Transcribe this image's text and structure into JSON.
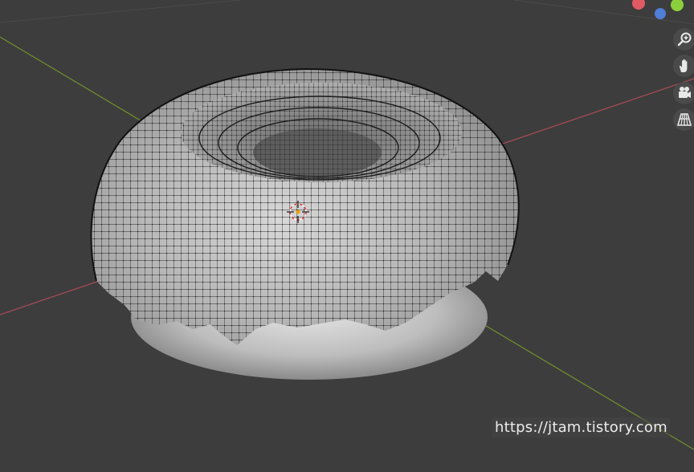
{
  "viewport": {
    "background_color": "#3d3d3d",
    "axis_x_color": "#a44a52",
    "axis_y_color": "#6f8b2e"
  },
  "gizmo": {
    "x_axis_color": "#e05a64",
    "y_axis_color": "#8ccf3c",
    "z_axis_color": "#4f7ed9"
  },
  "nav_buttons": [
    {
      "name": "zoom",
      "icon": "magnifier-plus-icon"
    },
    {
      "name": "pan",
      "icon": "hand-icon"
    },
    {
      "name": "camera",
      "icon": "camera-icon"
    },
    {
      "name": "perspective",
      "icon": "grid-perspective-icon"
    }
  ],
  "scene": {
    "object": "donut with icing mesh in edit mode",
    "cursor_icon": "3d-cursor-icon"
  },
  "watermark": {
    "text": "https://jtam.tistory.com"
  }
}
